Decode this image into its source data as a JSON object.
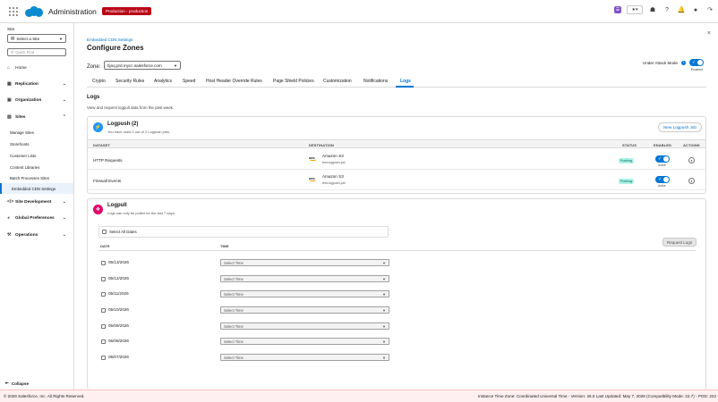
{
  "header": {
    "app_name": "Administration",
    "env_badge": "Production - production",
    "icons": [
      "app-launcher-icon",
      "salesforce-cloud-logo",
      "setup-assistant-icon",
      "favorites-icon",
      "trailhead-icon",
      "help-icon",
      "notifications-icon",
      "user-icon",
      "logout-icon"
    ]
  },
  "sidebar": {
    "site_label": "Site",
    "site_select_value": "Select a Site",
    "quick_find_placeholder": "Quick Find",
    "items": [
      {
        "label": "Home",
        "icon": "home-icon"
      },
      {
        "label": "Replication",
        "icon": "replication-icon"
      },
      {
        "label": "Organization",
        "icon": "organization-icon"
      },
      {
        "label": "Sites",
        "icon": "sites-icon"
      },
      {
        "label": "Manage Sites"
      },
      {
        "label": "Storefronts"
      },
      {
        "label": "Customer Lists"
      },
      {
        "label": "Content Libraries"
      },
      {
        "label": "Batch Processes Sites"
      },
      {
        "label": "Embedded CDN Settings"
      },
      {
        "label": "Site Development",
        "icon": "code-icon"
      },
      {
        "label": "Global Preferences",
        "icon": "globe-icon"
      },
      {
        "label": "Operations",
        "icon": "wrench-icon"
      }
    ],
    "collapse_label": "Collapse"
  },
  "main": {
    "breadcrumb": "Embedded CDN Settings",
    "title": "Configure Zones",
    "zone_label": "Zone:",
    "zone_value": "bjnq.prd.mycc.salesforce.com",
    "under_attack_label": "Under Attack Mode",
    "under_attack_status": "Enabled",
    "tabs": [
      "Crypto",
      "Security Rules",
      "Analytics",
      "Speed",
      "Host Header Override Rules",
      "Page Shield Policies",
      "Customization",
      "Notifications",
      "Logs"
    ],
    "active_tab": "Logs",
    "logs_heading": "Logs",
    "logs_description": "View and request logpull data from the past week."
  },
  "logpush": {
    "title": "Logpush (2)",
    "subtitle": "You have used 2 out of 2 Logpush jobs.",
    "new_button": "New Logpush Job",
    "columns": [
      "DATASET",
      "DESTINATION",
      "STATUS",
      "ENABLED",
      "ACTIONS"
    ],
    "rows": [
      {
        "dataset": "HTTP Requests",
        "destination": "Amazon S3",
        "destination_sub": "test-logpush-job",
        "status": "Pushing",
        "enabled_label": "Active"
      },
      {
        "dataset": "Firewall Events",
        "destination": "Amazon S3",
        "destination_sub": "test-logpush-job",
        "status": "Pushing",
        "enabled_label": "Active"
      }
    ]
  },
  "logpull": {
    "title": "Logpull",
    "subtitle": "Logs can only be pulled for the last 7 days.",
    "select_all": "Select All Dates",
    "request_button": "Request Logs",
    "col_date": "DATE",
    "col_time": "TIME",
    "time_placeholder": "Select Time",
    "dates": [
      "05/13/2026",
      "05/12/2026",
      "05/11/2026",
      "05/10/2026",
      "05/09/2026",
      "05/08/2026",
      "05/07/2026"
    ]
  },
  "footer": {
    "copyright": "© 2026 Salesforce, Inc. All Rights Reserved.",
    "info": "Instance Time Zone: Coordinated Universal Time  -  Version: 26.6 Last Updated: May 7, 2026 (Compatibility Mode: 22.7)  -  POD: 222"
  },
  "colors": {
    "brand_blue": "#0176d3",
    "env_badge": "#ba0517",
    "pushing_bg": "#acf3e4",
    "logpush_icon": "#1b96ff",
    "logpull_icon": "#e3066a"
  }
}
